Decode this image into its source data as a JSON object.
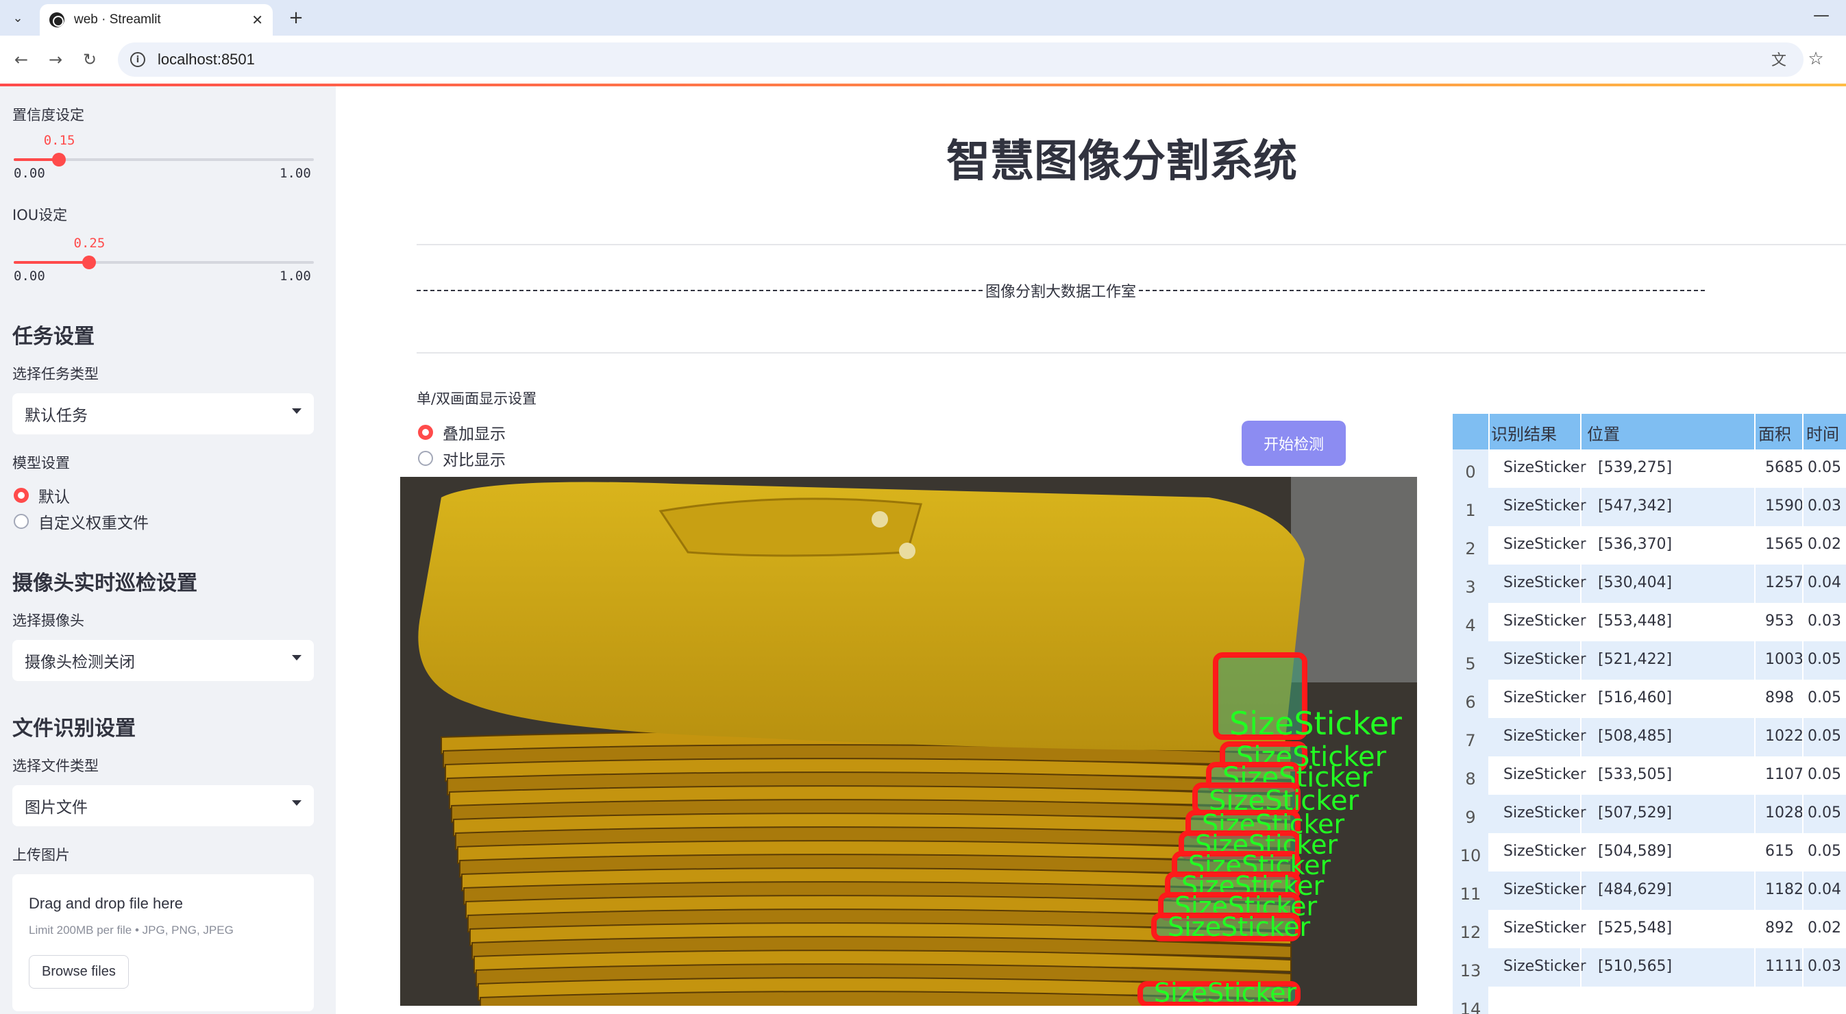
{
  "browser": {
    "tab_title": "web · Streamlit",
    "url": "localhost:8501"
  },
  "sidebar": {
    "confidence": {
      "label": "置信度设定",
      "value": "0.15",
      "min": "0.00",
      "max": "1.00",
      "fraction": 0.15
    },
    "iou": {
      "label": "IOU设定",
      "value": "0.25",
      "min": "0.00",
      "max": "1.00",
      "fraction": 0.25
    },
    "task_heading": "任务设置",
    "task_type_label": "选择任务类型",
    "task_type_value": "默认任务",
    "model_label": "模型设置",
    "model_options": [
      "默认",
      "自定义权重文件"
    ],
    "model_selected": 0,
    "camera_heading": "摄像头实时巡检设置",
    "camera_label": "选择摄像头",
    "camera_value": "摄像头检测关闭",
    "file_heading": "文件识别设置",
    "file_type_label": "选择文件类型",
    "file_type_value": "图片文件",
    "upload_label": "上传图片",
    "upload": {
      "title": "Drag and drop file here",
      "hint": "Limit 200MB per file • JPG, PNG, JPEG",
      "button": "Browse files"
    }
  },
  "main": {
    "title": "智慧图像分割系统",
    "divider_text": "图像分割大数据工作室",
    "display_mode_label": "单/双画面显示设置",
    "display_options": [
      "叠加显示",
      "对比显示"
    ],
    "display_selected": 0,
    "start_button": "开始检测",
    "detection_label": "SizeSticker"
  },
  "table": {
    "headers": [
      "识别结果",
      "位置",
      "面积",
      "时间"
    ],
    "rows": [
      {
        "idx": "0",
        "label": "SizeSticker",
        "pos": "[539,275]",
        "area": "5685",
        "time": "0.05"
      },
      {
        "idx": "1",
        "label": "SizeSticker",
        "pos": "[547,342]",
        "area": "1590",
        "time": "0.03"
      },
      {
        "idx": "2",
        "label": "SizeSticker",
        "pos": "[536,370]",
        "area": "1565",
        "time": "0.02"
      },
      {
        "idx": "3",
        "label": "SizeSticker",
        "pos": "[530,404]",
        "area": "1257",
        "time": "0.04"
      },
      {
        "idx": "4",
        "label": "SizeSticker",
        "pos": "[553,448]",
        "area": "953",
        "time": "0.03"
      },
      {
        "idx": "5",
        "label": "SizeSticker",
        "pos": "[521,422]",
        "area": "1003",
        "time": "0.05"
      },
      {
        "idx": "6",
        "label": "SizeSticker",
        "pos": "[516,460]",
        "area": "898",
        "time": "0.05"
      },
      {
        "idx": "7",
        "label": "SizeSticker",
        "pos": "[508,485]",
        "area": "1022",
        "time": "0.05"
      },
      {
        "idx": "8",
        "label": "SizeSticker",
        "pos": "[533,505]",
        "area": "1107",
        "time": "0.05"
      },
      {
        "idx": "9",
        "label": "SizeSticker",
        "pos": "[507,529]",
        "area": "1028",
        "time": "0.05"
      },
      {
        "idx": "10",
        "label": "SizeSticker",
        "pos": "[504,589]",
        "area": "615",
        "time": "0.05"
      },
      {
        "idx": "11",
        "label": "SizeSticker",
        "pos": "[484,629]",
        "area": "1182",
        "time": "0.04"
      },
      {
        "idx": "12",
        "label": "SizeSticker",
        "pos": "[525,548]",
        "area": "892",
        "time": "0.02"
      },
      {
        "idx": "13",
        "label": "SizeSticker",
        "pos": "[510,565]",
        "area": "1111",
        "time": "0.03"
      },
      {
        "idx": "14",
        "label": "",
        "pos": "",
        "area": "",
        "time": ""
      }
    ]
  },
  "colors": {
    "accent": "#ff4b4b",
    "sidebar_bg": "#f0f2f6",
    "button": "#8c8cf2",
    "table_header": "#7fbef2",
    "table_stripe": "#e3eefb",
    "shirt": "#c9a416",
    "mask_outline": "#ff1a1a",
    "mask_text": "#22ff22"
  }
}
